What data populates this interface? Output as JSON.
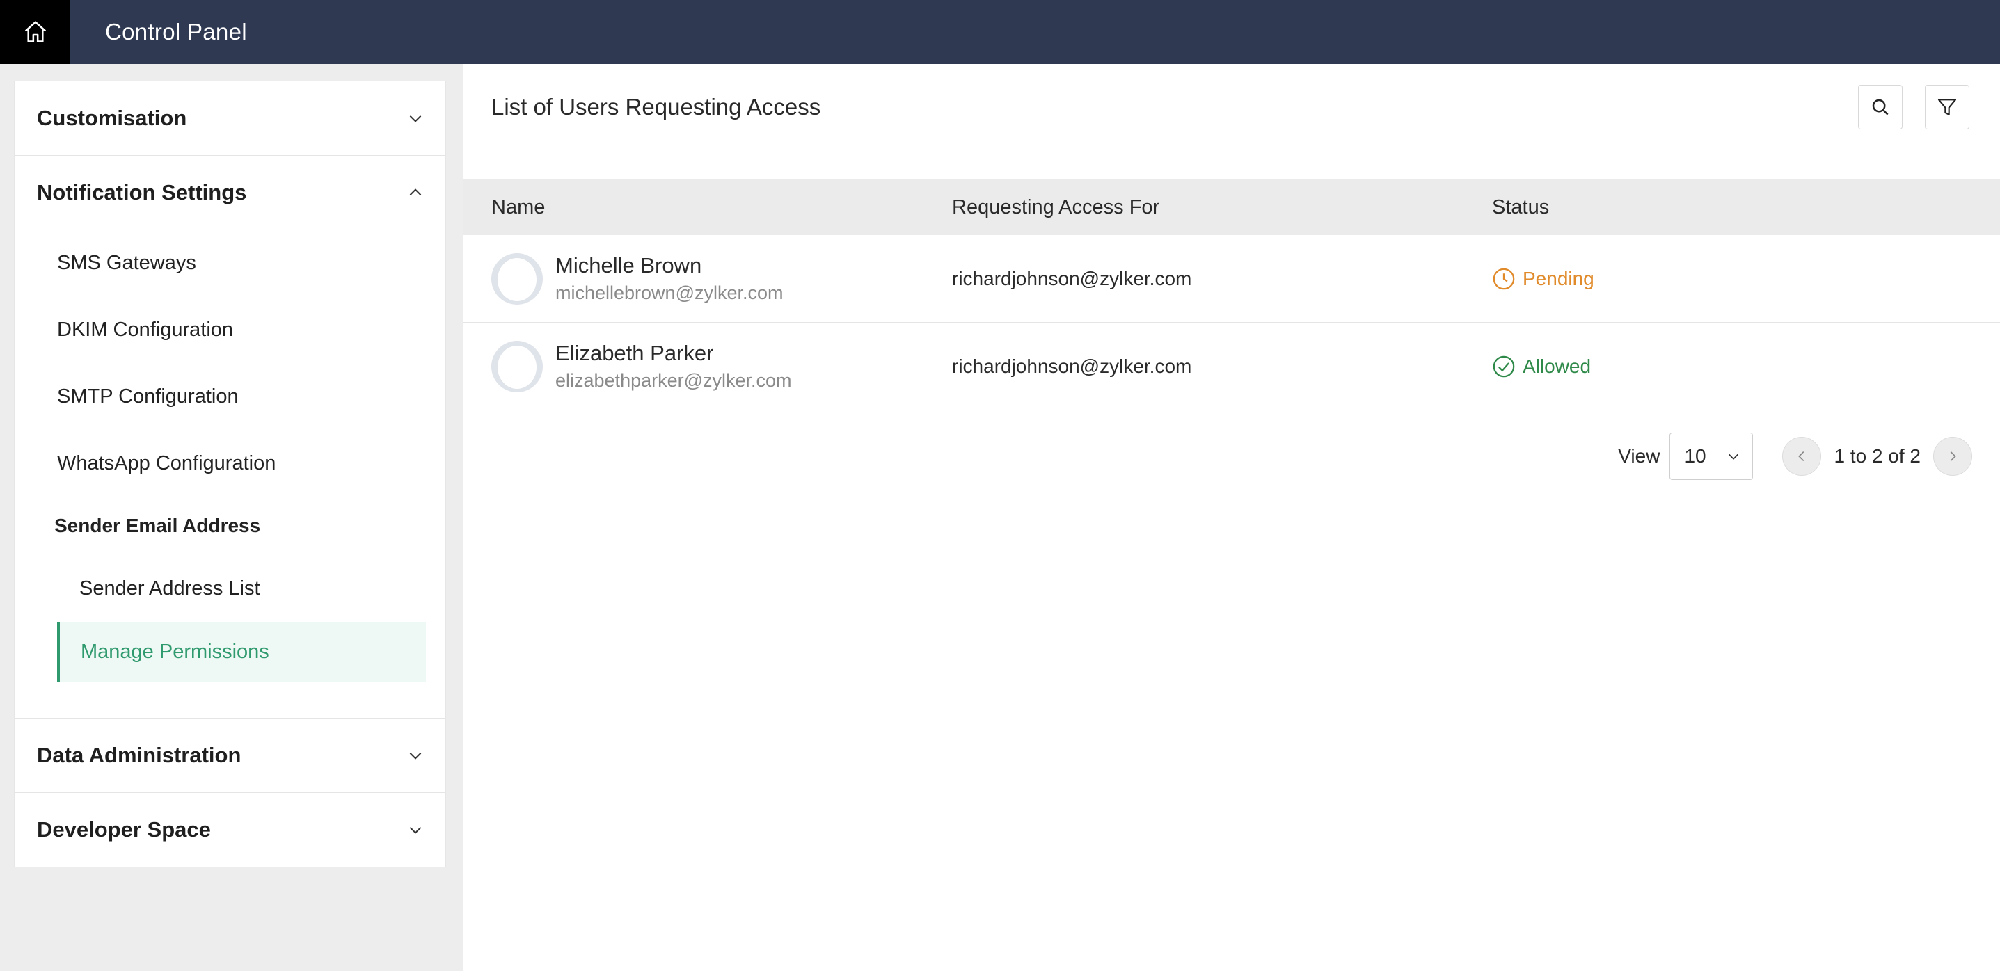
{
  "app": {
    "title": "Control Panel"
  },
  "sidebar": {
    "sections": {
      "customisation": "Customisation",
      "notification": "Notification Settings",
      "data_admin": "Data Administration",
      "developer": "Developer Space"
    },
    "notification_items": {
      "sms": "SMS Gateways",
      "dkim": "DKIM Configuration",
      "smtp": "SMTP Configuration",
      "whatsapp": "WhatsApp Configuration"
    },
    "sender_group": {
      "title": "Sender Email Address",
      "address_list": "Sender Address List",
      "manage_permissions": "Manage Permissions"
    }
  },
  "main": {
    "title": "List of Users Requesting Access",
    "columns": {
      "name": "Name",
      "requesting": "Requesting Access For",
      "status": "Status"
    },
    "rows": [
      {
        "name": "Michelle Brown",
        "email": "michellebrown@zylker.com",
        "requesting": "richardjohnson@zylker.com",
        "status": "Pending"
      },
      {
        "name": "Elizabeth Parker",
        "email": "elizabethparker@zylker.com",
        "requesting": "richardjohnson@zylker.com",
        "status": "Allowed"
      }
    ],
    "pager": {
      "view_label": "View",
      "page_size": "10",
      "range": "1 to 2 of 2"
    }
  },
  "colors": {
    "topbar": "#2f3a52",
    "accent": "#2f9a6e",
    "pending": "#e08a2a",
    "allowed": "#2f8a4a"
  },
  "icons": [
    "home-icon",
    "search-icon",
    "filter-icon",
    "chevron-down-icon",
    "chevron-up-icon",
    "clock-icon",
    "check-circle-icon",
    "chevron-left-icon",
    "chevron-right-icon"
  ]
}
